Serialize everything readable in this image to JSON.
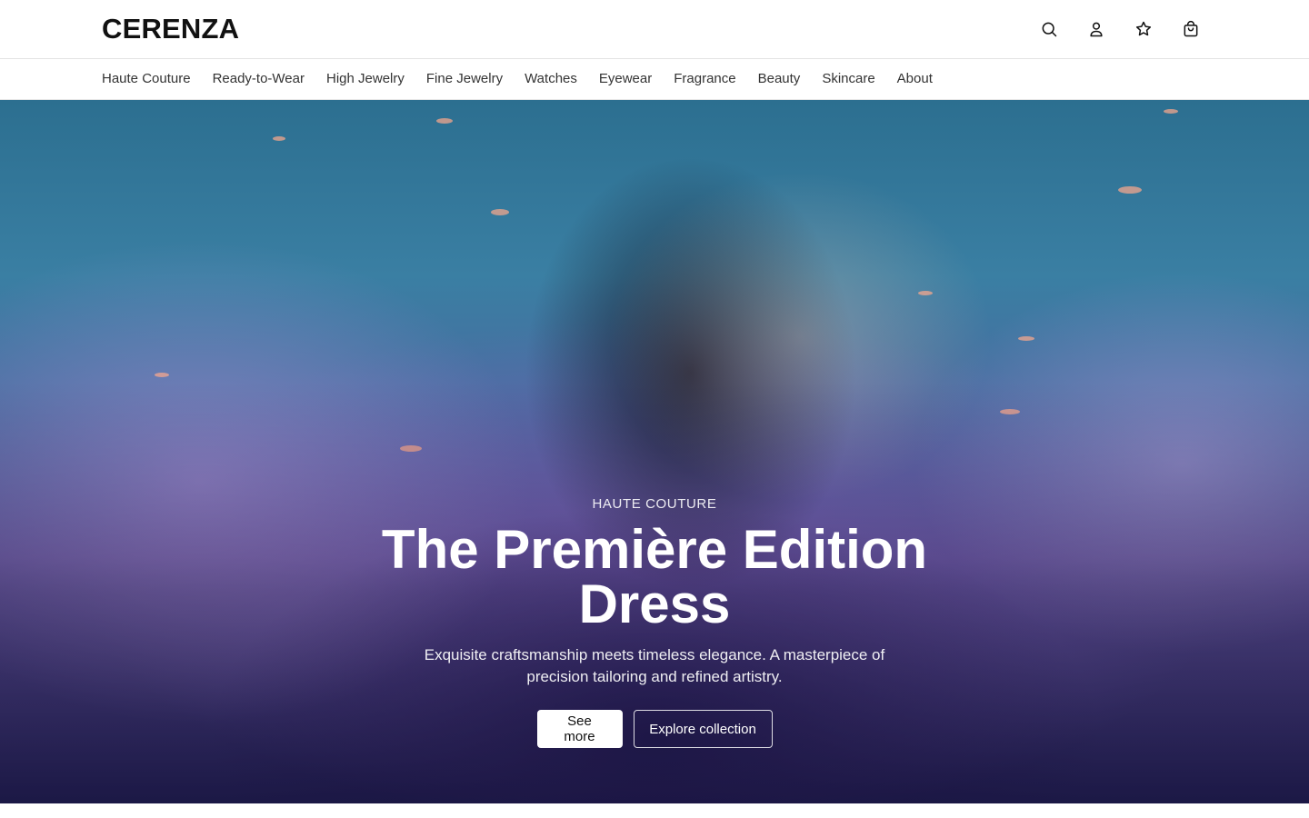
{
  "header": {
    "logo": "CERENZA",
    "icons": [
      "search-icon",
      "user-icon",
      "star-icon",
      "bag-icon"
    ]
  },
  "nav": {
    "items": [
      {
        "label": "Haute Couture"
      },
      {
        "label": "Ready-to-Wear"
      },
      {
        "label": "High Jewelry"
      },
      {
        "label": "Fine Jewelry"
      },
      {
        "label": "Watches"
      },
      {
        "label": "Eyewear"
      },
      {
        "label": "Fragrance"
      },
      {
        "label": "Beauty"
      },
      {
        "label": "Skincare"
      },
      {
        "label": "About"
      }
    ]
  },
  "hero": {
    "eyebrow": "HAUTE COUTURE",
    "title": "The Première Edition Dress",
    "description": "Exquisite craftsmanship meets timeless elegance. A masterpiece of precision tailoring and refined artistry.",
    "primary_cta": "See more",
    "secondary_cta": "Explore collection"
  },
  "colors": {
    "text": "#111111",
    "border": "#e3e3e3",
    "hero_top": "#2c6f90",
    "hero_bottom": "#2a2560"
  }
}
